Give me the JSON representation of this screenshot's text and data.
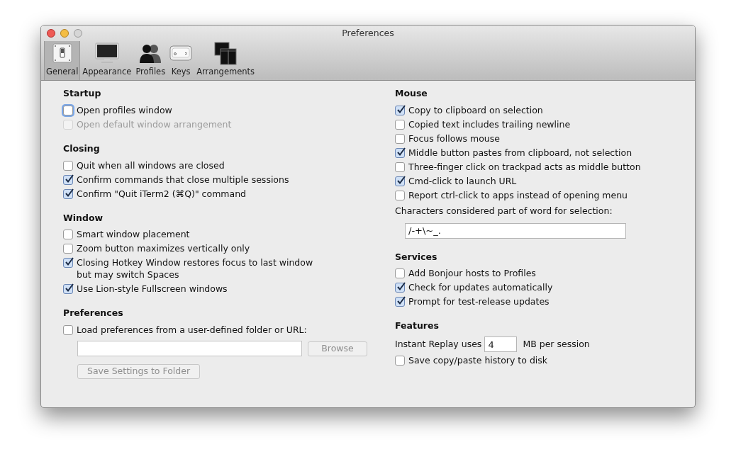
{
  "window": {
    "title": "Preferences"
  },
  "toolbar": [
    {
      "label": "General",
      "selected": true
    },
    {
      "label": "Appearance",
      "selected": false
    },
    {
      "label": "Profiles",
      "selected": false
    },
    {
      "label": "Keys",
      "selected": false
    },
    {
      "label": "Arrangements",
      "selected": false
    }
  ],
  "left_sections": [
    {
      "title": "Startup",
      "items": [
        {
          "kind": "checkbox",
          "label": "Open profiles window",
          "checked": false,
          "disabled": false,
          "focused": true
        },
        {
          "kind": "checkbox",
          "label": "Open default window arrangement",
          "checked": false,
          "disabled": true,
          "focused": false
        }
      ]
    },
    {
      "title": "Closing",
      "items": [
        {
          "kind": "checkbox",
          "label": "Quit when all windows are closed",
          "checked": false,
          "disabled": false,
          "focused": false
        },
        {
          "kind": "checkbox",
          "label": "Confirm commands that close multiple sessions",
          "checked": true,
          "disabled": false,
          "focused": false
        },
        {
          "kind": "checkbox",
          "label": "Confirm \"Quit iTerm2 (⌘Q)\" command",
          "checked": true,
          "disabled": false,
          "focused": false
        }
      ]
    },
    {
      "title": "Window",
      "items": [
        {
          "kind": "checkbox",
          "label": "Smart window placement",
          "checked": false,
          "disabled": false,
          "focused": false
        },
        {
          "kind": "checkbox",
          "label": "Zoom button maximizes vertically only",
          "checked": false,
          "disabled": false,
          "focused": false
        },
        {
          "kind": "checkbox",
          "label": "Closing Hotkey Window restores focus to last window\n but may switch Spaces",
          "checked": true,
          "disabled": false,
          "focused": false
        },
        {
          "kind": "checkbox",
          "label": "Use Lion-style Fullscreen windows",
          "checked": true,
          "disabled": false,
          "focused": false
        }
      ]
    },
    {
      "title": "Preferences",
      "items": [
        {
          "kind": "checkbox",
          "label": "Load preferences from a user-defined folder or URL:",
          "checked": false,
          "disabled": false,
          "focused": false
        },
        {
          "kind": "path_row",
          "button": "Browse",
          "disabled": true
        },
        {
          "kind": "button",
          "label": "Save Settings to Folder",
          "disabled": true
        }
      ]
    }
  ],
  "right_sections": [
    {
      "title": "Mouse",
      "items": [
        {
          "kind": "checkbox",
          "label": "Copy to clipboard on selection",
          "checked": true,
          "disabled": false,
          "focused": false
        },
        {
          "kind": "checkbox",
          "label": "Copied text includes trailing newline",
          "checked": false,
          "disabled": false,
          "focused": false
        },
        {
          "kind": "checkbox",
          "label": "Focus follows mouse",
          "checked": false,
          "disabled": false,
          "focused": false
        },
        {
          "kind": "checkbox",
          "label": "Middle button pastes from clipboard, not selection",
          "checked": true,
          "disabled": false,
          "focused": false
        },
        {
          "kind": "checkbox",
          "label": "Three-finger click on trackpad acts as middle button",
          "checked": false,
          "disabled": false,
          "focused": false
        },
        {
          "kind": "checkbox",
          "label": "Cmd-click to launch URL",
          "checked": true,
          "disabled": false,
          "focused": false
        },
        {
          "kind": "checkbox",
          "label": "Report ctrl-click to apps instead of opening menu",
          "checked": false,
          "disabled": false,
          "focused": false
        },
        {
          "kind": "label",
          "label": "Characters considered part of word for selection:"
        },
        {
          "kind": "field",
          "value": "/-+\\~_."
        }
      ]
    },
    {
      "title": "Services",
      "items": [
        {
          "kind": "checkbox",
          "label": "Add Bonjour hosts to Profiles",
          "checked": false,
          "disabled": false,
          "focused": false
        },
        {
          "kind": "checkbox",
          "label": "Check for updates automatically",
          "checked": true,
          "disabled": false,
          "focused": false
        },
        {
          "kind": "checkbox",
          "label": "Prompt for test-release updates",
          "checked": true,
          "disabled": false,
          "focused": false
        }
      ]
    },
    {
      "title": "Features",
      "items": [
        {
          "kind": "inline_field",
          "before": "Instant Replay uses",
          "value": "4",
          "after": "MB per session"
        },
        {
          "kind": "checkbox",
          "label": "Save copy/paste history to disk",
          "checked": false,
          "disabled": false,
          "focused": false
        }
      ]
    }
  ]
}
